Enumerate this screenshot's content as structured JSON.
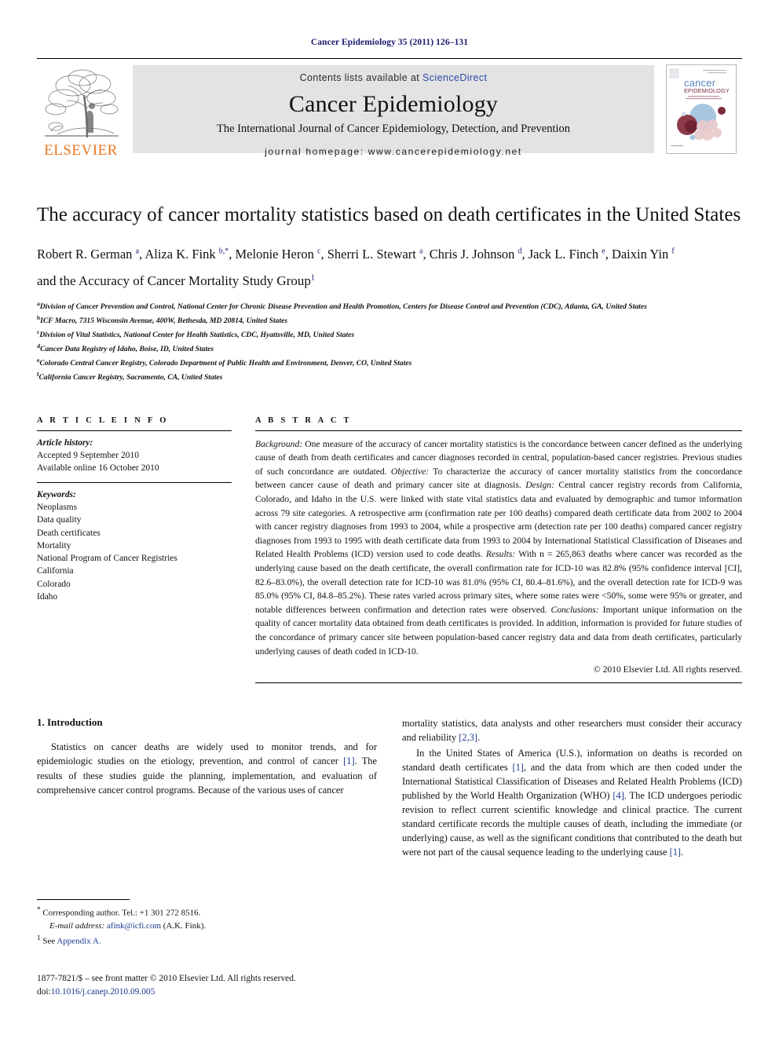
{
  "running_head": "Cancer Epidemiology 35 (2011) 126–131",
  "masthead": {
    "publisher_logo_label": "ELSEVIER",
    "contents_prefix": "Contents lists available at ",
    "contents_link": "ScienceDirect",
    "journal_title": "Cancer Epidemiology",
    "journal_subtitle": "The International Journal of Cancer Epidemiology, Detection, and Prevention",
    "homepage": "journal homepage: www.cancerepidemiology.net",
    "cover_title_line1": "cancer",
    "cover_title_line2": "EPIDEMIOLOGY"
  },
  "article": {
    "title": "The accuracy of cancer mortality statistics based on death certificates in the United States",
    "authors_html": "Robert R. German <sup>a</sup>, Aliza K. Fink <sup>b,*</sup>, Melonie Heron <sup>c</sup>, Sherri L. Stewart <sup>a</sup>, Chris J. Johnson <sup>d</sup>, Jack L. Finch <sup>e</sup>, Daixin Yin <sup>f</sup>",
    "group_html": "and the Accuracy of Cancer Mortality Study Group<sup>1</sup>",
    "affiliations": [
      {
        "marker": "a",
        "text": "Division of Cancer Prevention and Control, National Center for Chronic Disease Prevention and Health Promotion, Centers for Disease Control and Prevention (CDC), Atlanta, GA, United States"
      },
      {
        "marker": "b",
        "text": "ICF Macro, 7315 Wisconsin Avenue, 400W, Bethesda, MD 20814, United States"
      },
      {
        "marker": "c",
        "text": "Division of Vital Statistics, National Center for Health Statistics, CDC, Hyattsville, MD, United States"
      },
      {
        "marker": "d",
        "text": "Cancer Data Registry of Idaho, Boise, ID, United States"
      },
      {
        "marker": "e",
        "text": "Colorado Central Cancer Registry, Colorado Department of Public Health and Environment, Denver, CO, United States"
      },
      {
        "marker": "f",
        "text": "California Cancer Registry, Sacramento, CA, United States"
      }
    ]
  },
  "article_info": {
    "heading": "A R T I C L E   I N F O",
    "history_label": "Article history:",
    "history": [
      "Accepted 9 September 2010",
      "Available online 16 October 2010"
    ],
    "keywords_label": "Keywords:",
    "keywords": [
      "Neoplasms",
      "Data quality",
      "Death certificates",
      "Mortality",
      "National Program of Cancer Registries",
      "California",
      "Colorado",
      "Idaho"
    ]
  },
  "abstract": {
    "heading": "A B S T R A C T",
    "sections": [
      {
        "label": "Background:",
        "text": " One measure of the accuracy of cancer mortality statistics is the concordance between cancer defined as the underlying cause of death from death certificates and cancer diagnoses recorded in central, population-based cancer registries. Previous studies of such concordance are outdated. "
      },
      {
        "label": "Objective:",
        "text": " To characterize the accuracy of cancer mortality statistics from the concordance between cancer cause of death and primary cancer site at diagnosis. "
      },
      {
        "label": "Design:",
        "text": " Central cancer registry records from California, Colorado, and Idaho in the U.S. were linked with state vital statistics data and evaluated by demographic and tumor information across 79 site categories. A retrospective arm (confirmation rate per 100 deaths) compared death certificate data from 2002 to 2004 with cancer registry diagnoses from 1993 to 2004, while a prospective arm (detection rate per 100 deaths) compared cancer registry diagnoses from 1993 to 1995 with death certificate data from 1993 to 2004 by International Statistical Classification of Diseases and Related Health Problems (ICD) version used to code deaths. "
      },
      {
        "label": "Results:",
        "text": " With n = 265,863 deaths where cancer was recorded as the underlying cause based on the death certificate, the overall confirmation rate for ICD-10 was 82.8% (95% confidence interval [CI], 82.6–83.0%), the overall detection rate for ICD-10 was 81.0% (95% CI, 80.4–81.6%), and the overall detection rate for ICD-9 was 85.0% (95% CI, 84.8–85.2%). These rates varied across primary sites, where some rates were <50%, some were 95% or greater, and notable differences between confirmation and detection rates were observed. "
      },
      {
        "label": "Conclusions:",
        "text": " Important unique information on the quality of cancer mortality data obtained from death certificates is provided. In addition, information is provided for future studies of the concordance of primary cancer site between population-based cancer registry data and data from death certificates, particularly underlying causes of death coded in ICD-10."
      }
    ],
    "copyright": "© 2010 Elsevier Ltd. All rights reserved."
  },
  "body": {
    "section_heading": "1. Introduction",
    "left_paragraphs": [
      {
        "parts": [
          {
            "t": "Statistics on cancer deaths are widely used to monitor trends, and for epidemiologic studies on the etiology, prevention, and control of cancer "
          },
          {
            "t": "[1]",
            "ref": true
          },
          {
            "t": ". The results of these studies guide the planning, implementation, and evaluation of comprehensive cancer control programs. Because of the various uses of cancer"
          }
        ]
      }
    ],
    "right_paragraphs": [
      {
        "indent": false,
        "parts": [
          {
            "t": "mortality statistics, data analysts and other researchers must consider their accuracy and reliability "
          },
          {
            "t": "[2,3]",
            "ref": true
          },
          {
            "t": "."
          }
        ]
      },
      {
        "indent": true,
        "parts": [
          {
            "t": "In the United States of America (U.S.), information on deaths is recorded on standard death certificates "
          },
          {
            "t": "[1]",
            "ref": true
          },
          {
            "t": ", and the data from which are then coded under the International Statistical Classification of Diseases and Related Health Problems (ICD) published by the World Health Organization (WHO) "
          },
          {
            "t": "[4]",
            "ref": true
          },
          {
            "t": ". The ICD undergoes periodic revision to reflect current scientific knowledge and clinical practice. The current standard certificate records the multiple causes of death, including the immediate (or underlying) cause, as well as the significant conditions that contributed to the death but were not part of the causal sequence leading to the underlying cause "
          },
          {
            "t": "[1]",
            "ref": true
          },
          {
            "t": "."
          }
        ]
      }
    ]
  },
  "footnotes": {
    "corresponding_marker": "*",
    "corresponding_text": "Corresponding author. Tel.: +1 301 272 8516.",
    "email_label": "E-mail address:",
    "email": "afink@icfi.com",
    "email_suffix": "(A.K. Fink).",
    "appendix_marker": "1",
    "appendix_prefix": "See ",
    "appendix_link": "Appendix A.",
    "issn_line": "1877-7821/$ – see front matter © 2010 Elsevier Ltd. All rights reserved.",
    "doi_prefix": "doi:",
    "doi": "10.1016/j.canep.2010.09.005"
  },
  "colors": {
    "link_blue": "#2b49a8",
    "ref_blue": "#1a3a8f",
    "elsevier_orange": "#E87722",
    "banner_gray": "#e3e3e3",
    "cover_blue": "#a8c6e0",
    "cover_maroon": "#7b2b3a"
  }
}
